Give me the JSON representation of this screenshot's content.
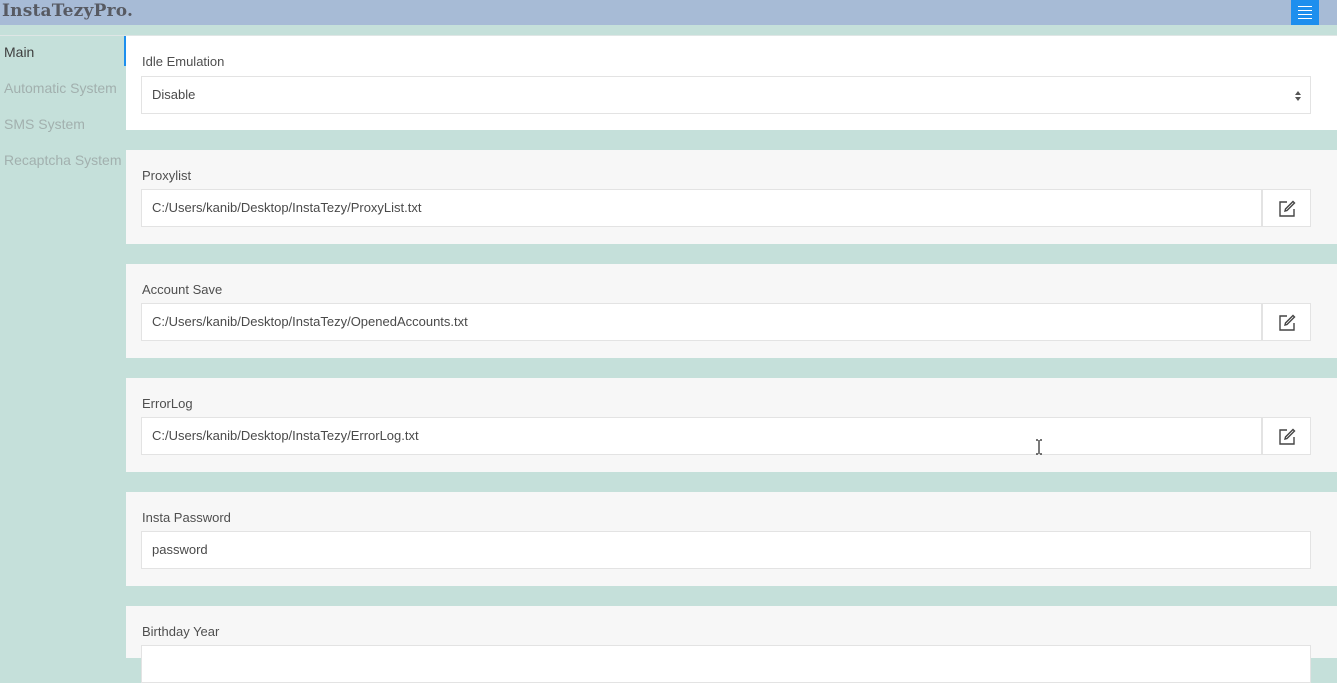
{
  "app": {
    "title": "InstaTezyPro."
  },
  "sidebar": {
    "items": [
      {
        "label": "Main",
        "active": true
      },
      {
        "label": "Automatic System",
        "active": false
      },
      {
        "label": "SMS System",
        "active": false
      },
      {
        "label": "Recaptcha System",
        "active": false
      }
    ]
  },
  "settings": {
    "idle_emulation": {
      "label": "Idle Emulation",
      "value": "Disable"
    },
    "proxylist": {
      "label": "Proxylist",
      "value": "C:/Users/kanib/Desktop/InstaTezy/ProxyList.txt"
    },
    "account_save": {
      "label": "Account Save",
      "value": "C:/Users/kanib/Desktop/InstaTezy/OpenedAccounts.txt"
    },
    "error_log": {
      "label": "ErrorLog",
      "value": "C:/Users/kanib/Desktop/InstaTezy/ErrorLog.txt"
    },
    "insta_password": {
      "label": "Insta Password",
      "value": "password"
    },
    "birthday_year": {
      "label": "Birthday Year",
      "value": ""
    }
  },
  "colors": {
    "topbar": "#a7bbd6",
    "accent": "#1d8fee",
    "sidebar_bg": "#c5e0da",
    "card_bg": "#f7f7f7"
  },
  "icons": {
    "menu": "hamburger-icon",
    "edit": "edit-icon",
    "select": "select-arrows-icon"
  }
}
